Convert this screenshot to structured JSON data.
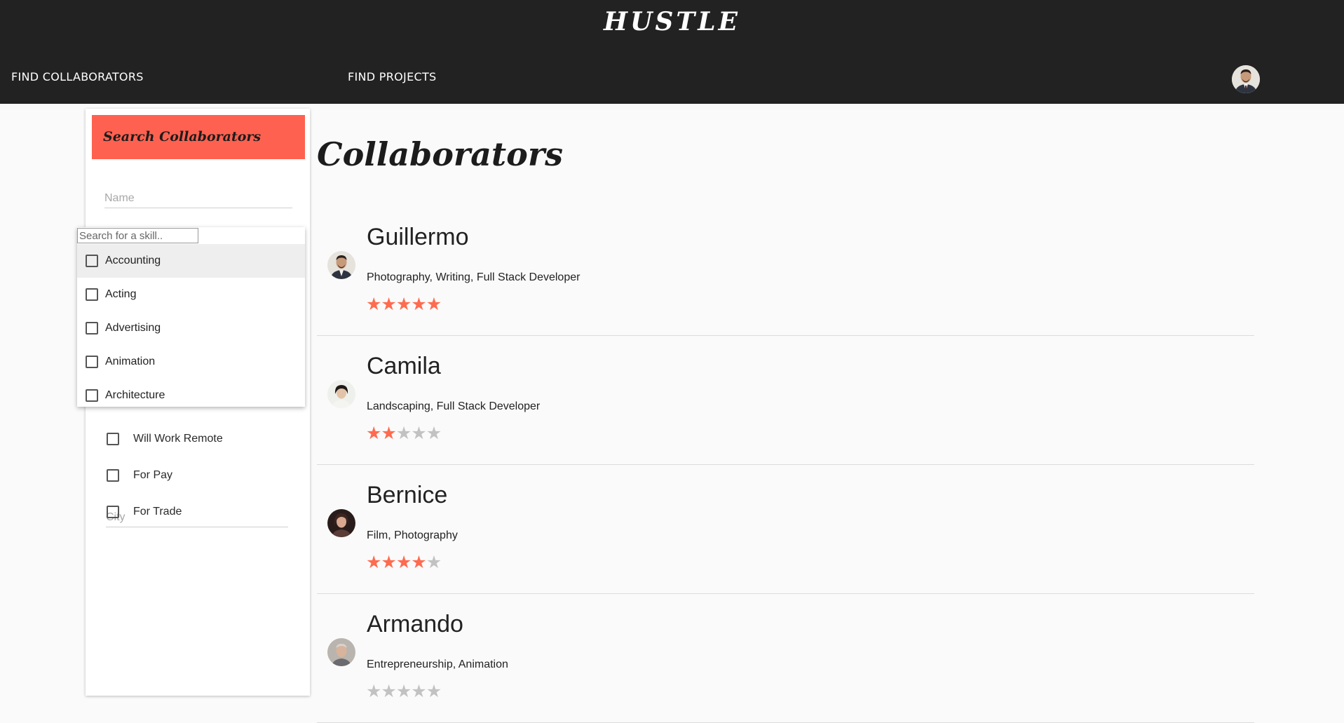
{
  "header": {
    "logo": "HUSTLE",
    "nav": {
      "find_collaborators": "FIND COLLABORATORS",
      "find_projects": "FIND PROJECTS"
    }
  },
  "sidebar": {
    "title": "Search Collaborators",
    "name_placeholder": "Name",
    "skill_search_placeholder": "Search for a skill..",
    "skills": [
      "Accounting",
      "Acting",
      "Advertising",
      "Animation",
      "Architecture"
    ],
    "city_placeholder": "City",
    "filters": [
      "Will Work Remote",
      "For Pay",
      "For Trade"
    ]
  },
  "main": {
    "title": "Collaborators",
    "collaborators": [
      {
        "name": "Guillermo",
        "skills": "Photography, Writing, Full Stack Developer",
        "rating": 5
      },
      {
        "name": "Camila",
        "skills": "Landscaping, Full Stack Developer",
        "rating": 2
      },
      {
        "name": "Bernice",
        "skills": "Film, Photography",
        "rating": 4
      },
      {
        "name": "Armando",
        "skills": "Entrepreneurship, Animation",
        "rating": 0
      }
    ]
  },
  "colors": {
    "header_bg": "#222222",
    "accent": "#ff6150",
    "star_on": "#ff6b4f",
    "star_off": "#c2c2c2"
  }
}
